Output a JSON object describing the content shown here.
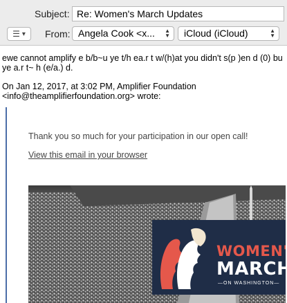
{
  "compose": {
    "subject_label": "Subject:",
    "subject_value": "Re: Women's March Updates",
    "from_label": "From:",
    "from_value": "Angela Cook <x...",
    "account_value": "iCloud (iCloud)",
    "menu_icon": "list-icon"
  },
  "body": {
    "reply_text": "ewe cannot amplify e b/b~u ye t/h ea.r t w/(h)at you didn't s(p )en d (0) bu ye a.r t~ h (e/a.) d.",
    "quote_header_line1": "On Jan 12, 2017, at 3:02 PM, Amplifier Foundation",
    "quote_header_line2": "<info@theamplifierfoundation.org> wrote:"
  },
  "quoted_email": {
    "thanks_text": "Thank you so much for your participation in our open call!",
    "view_link_text": "View this email in your browser",
    "logo_line1": "WOMEN'S",
    "logo_line2": "MARCH",
    "logo_line3": "ON WASHINGTON"
  },
  "colors": {
    "quote_bar": "#4a6da8",
    "logo_bg": "#1f2d47",
    "logo_red": "#e5584b"
  }
}
